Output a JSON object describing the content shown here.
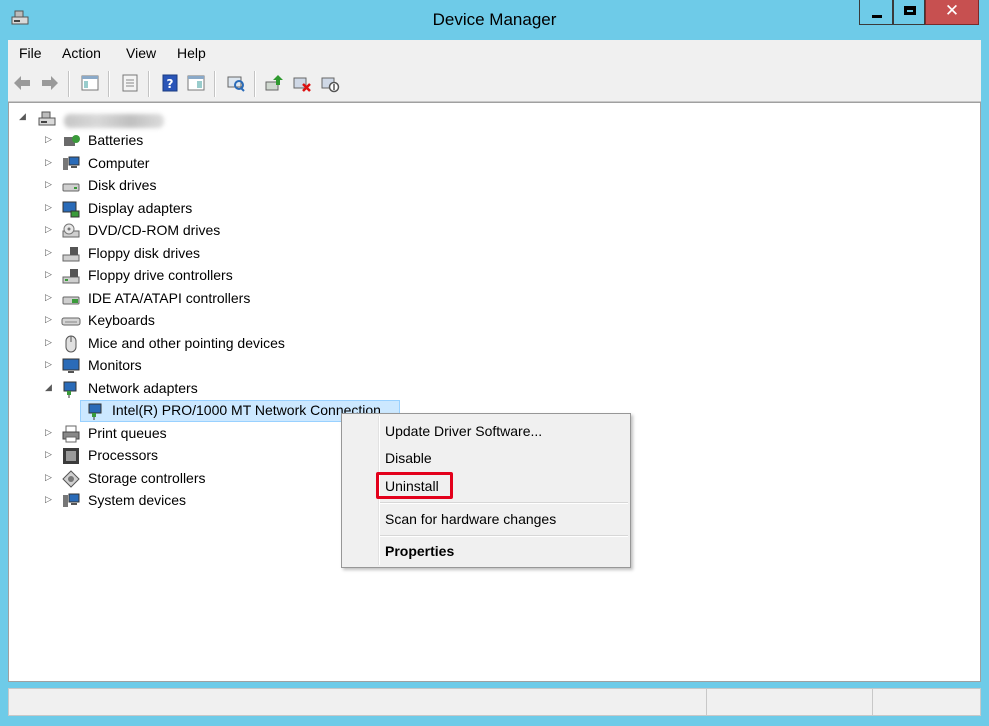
{
  "window": {
    "title": "Device Manager"
  },
  "menu": [
    "File",
    "Action",
    "View",
    "Help"
  ],
  "toolbar": [
    "back-icon",
    "forward-icon",
    "console-tree-icon",
    "properties-icon",
    "help-icon",
    "action-pane-icon",
    "scan-hardware-icon",
    "update-driver-icon",
    "uninstall-device-icon",
    "disable-device-icon"
  ],
  "tree": {
    "items": [
      "Batteries",
      "Computer",
      "Disk drives",
      "Display adapters",
      "DVD/CD-ROM drives",
      "Floppy disk drives",
      "Floppy drive controllers",
      "IDE ATA/ATAPI controllers",
      "Keyboards",
      "Mice and other pointing devices",
      "Monitors",
      "Network adapters",
      "Intel(R) PRO/1000 MT Network Connection",
      "Print queues",
      "Processors",
      "Storage controllers",
      "System devices"
    ]
  },
  "context_menu": {
    "items": [
      "Update Driver Software...",
      "Disable",
      "Uninstall",
      "Scan for hardware changes",
      "Properties"
    ]
  },
  "colors": {
    "titlebar": "#6ecbe8",
    "close": "#c75050",
    "highlight_box": "#e3001b",
    "selection": "#cce8ff"
  }
}
